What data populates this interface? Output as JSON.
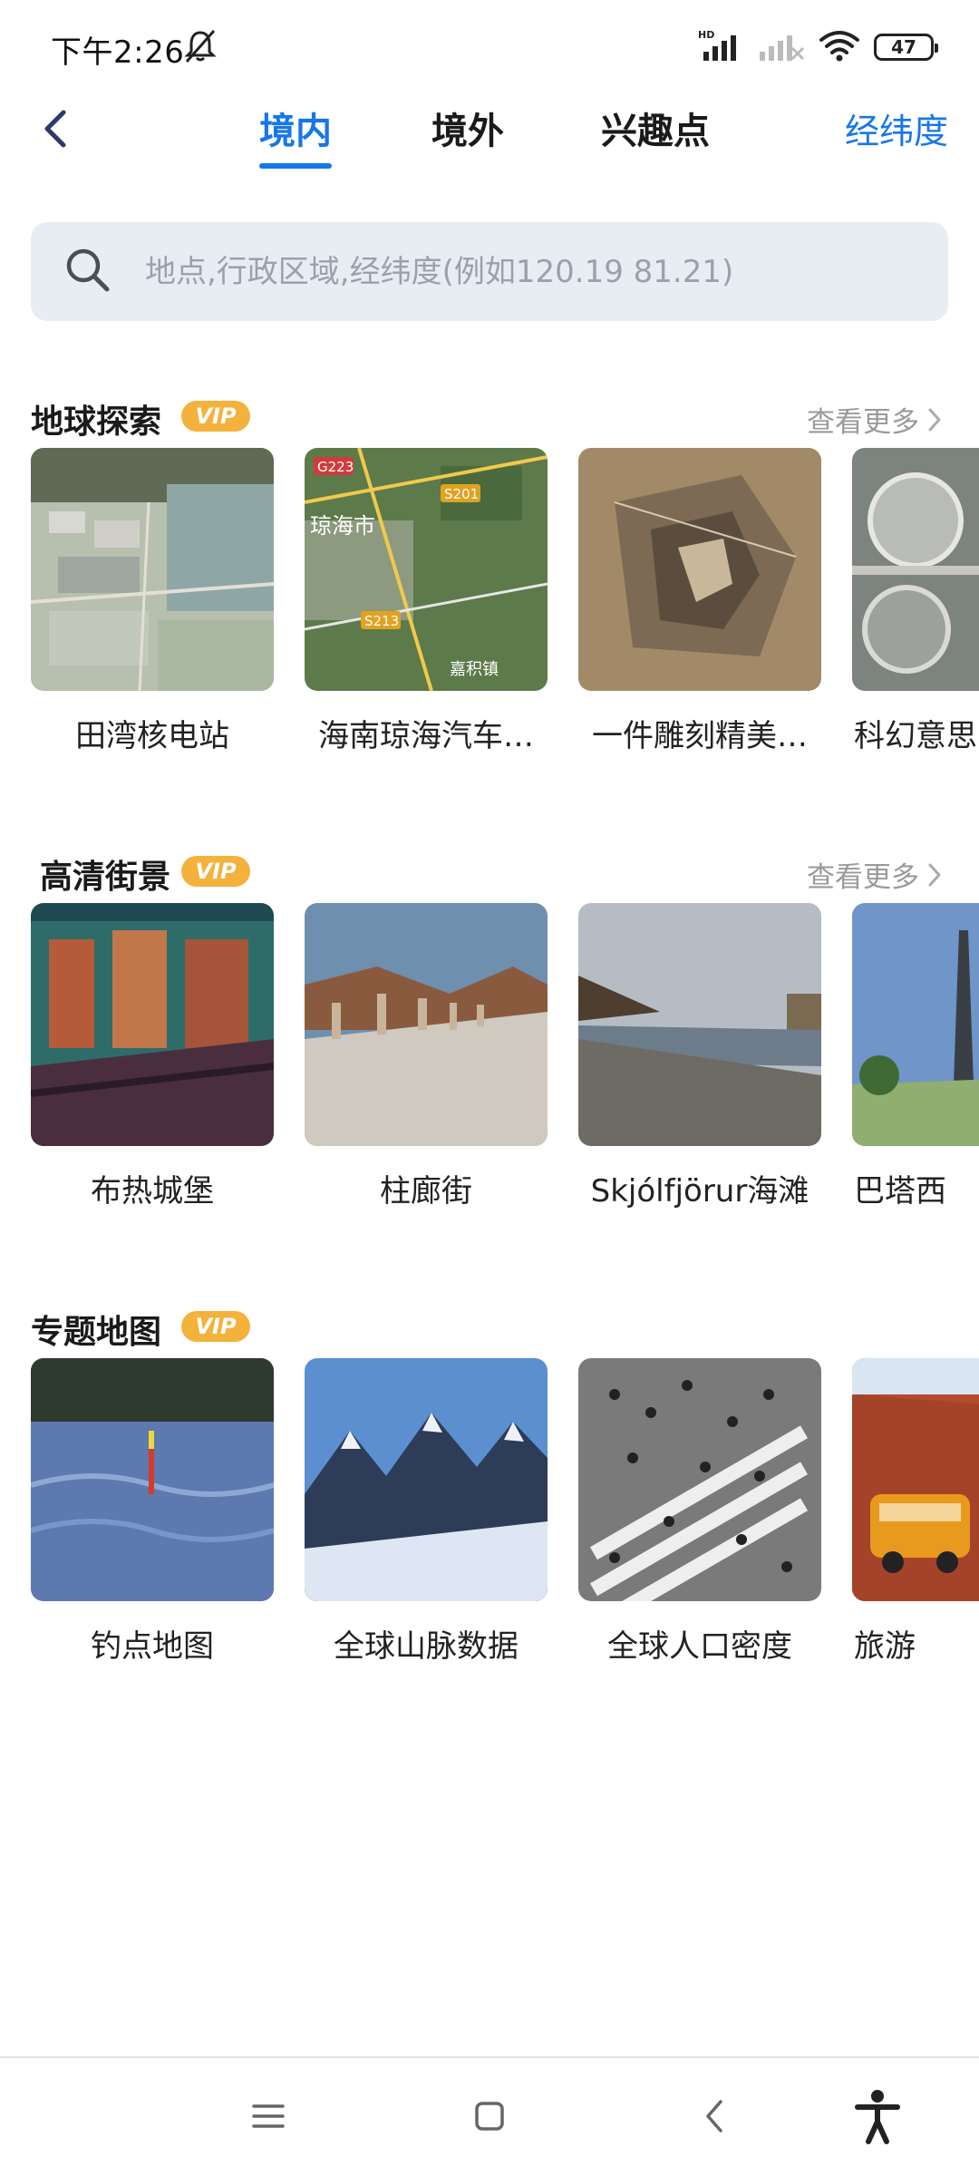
{
  "status_bar": {
    "time": "下午2:26",
    "battery": "47",
    "network": "HD"
  },
  "nav": {
    "tabs": [
      {
        "label": "境内",
        "active": true
      },
      {
        "label": "境外",
        "active": false
      },
      {
        "label": "兴趣点",
        "active": false
      }
    ],
    "coordinate_label": "经纬度"
  },
  "search": {
    "placeholder": "地点,行政区域,经纬度(例如120.19 81.21)"
  },
  "sections": [
    {
      "title": "地球探索",
      "badge": "VIP",
      "more": "查看更多",
      "items": [
        "田湾核电站",
        "海南琼海汽车…",
        "一件雕刻精美…",
        "科幻意思"
      ]
    },
    {
      "title": "高清街景",
      "badge": "VIP",
      "more": "查看更多",
      "items": [
        "布热城堡",
        "柱廊街",
        "Skjólfjörur海滩",
        "巴塔西"
      ]
    },
    {
      "title": "专题地图",
      "badge": "VIP",
      "items": [
        "钓点地图",
        "全球山脉数据",
        "全球人口密度",
        "旅游"
      ]
    }
  ],
  "map_labels": {
    "road1": "G223",
    "road2": "S201",
    "road3": "S213",
    "city": "琼海市",
    "town": "嘉积镇"
  },
  "colors": {
    "accent": "#1677e8",
    "vip": "#f3b23c",
    "search_bg": "#e8edf4"
  }
}
